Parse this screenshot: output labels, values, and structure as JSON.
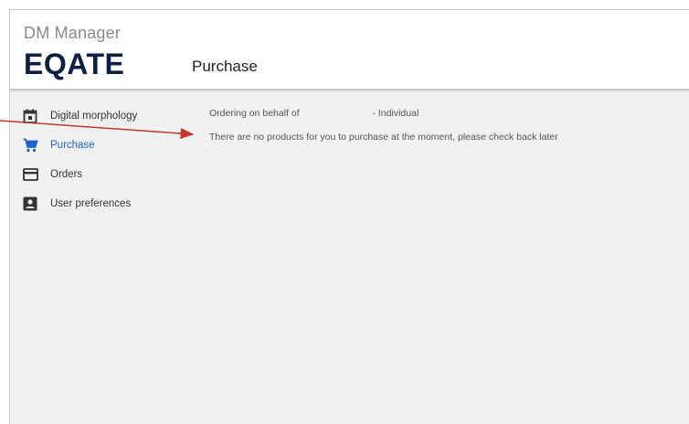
{
  "header": {
    "app_title": "DM Manager",
    "logo_text": "EQATE",
    "page_title": "Purchase"
  },
  "sidebar": {
    "items": [
      {
        "label": "Digital morphology",
        "icon": "calendar-icon",
        "active": false
      },
      {
        "label": "Purchase",
        "icon": "cart-icon",
        "active": true
      },
      {
        "label": "Orders",
        "icon": "credit-card-icon",
        "active": false
      },
      {
        "label": "User preferences",
        "icon": "account-box-icon",
        "active": false
      }
    ]
  },
  "main": {
    "ordering_prefix": "Ordering on behalf of",
    "ordering_suffix": "- Individual",
    "empty_message": "There are no products for you to purchase at the moment, please check back later"
  },
  "colors": {
    "accent": "#1e64c8",
    "logo": "#0e1f3f",
    "annotation_arrow": "#c0392b",
    "background": "#f1f1f1"
  }
}
